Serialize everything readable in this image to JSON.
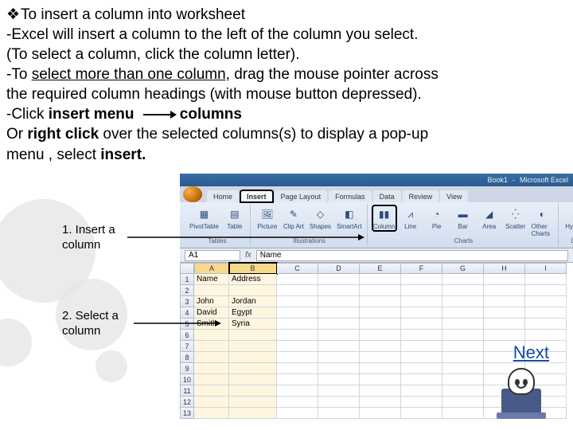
{
  "instructions": {
    "heading_bullet": "❖",
    "heading": "To insert a column into worksheet",
    "line1": "-Excel will insert a column to the left of the column you select.",
    "line2": "(To select a column, click the column letter).",
    "line3_pre": "-To ",
    "line3_under": "select more than one column,",
    "line3_post": " drag the mouse pointer across",
    "line4": "the required column headings (with mouse button depressed).",
    "line5_pre": "-Click ",
    "line5_b1": "insert menu",
    "line5_b2": "columns",
    "line6_pre": "Or ",
    "line6_b": "right click",
    "line6_post": " over the selected columns(s) to display a pop-up",
    "line7_pre": "menu , select ",
    "line7_b": "insert."
  },
  "callouts": {
    "c1": "1. Insert a column",
    "c2": "2. Select a column"
  },
  "excel": {
    "title_doc": "Book1",
    "title_app": "Microsoft Excel",
    "tabs": [
      "Home",
      "Insert",
      "Page Layout",
      "Formulas",
      "Data",
      "Review",
      "View"
    ],
    "active_tab": "Insert",
    "ribbon": [
      {
        "label": "PivotTable",
        "icon": "▦"
      },
      {
        "label": "Table",
        "icon": "▤"
      },
      {
        "label": "Picture",
        "icon": "🖼"
      },
      {
        "label": "Clip Art",
        "icon": "✎"
      },
      {
        "label": "Shapes",
        "icon": "◇"
      },
      {
        "label": "SmartArt",
        "icon": "◧"
      },
      {
        "label": "Column",
        "icon": "▮▮",
        "highlight": true
      },
      {
        "label": "Line",
        "icon": "⩘"
      },
      {
        "label": "Pie",
        "icon": "◔"
      },
      {
        "label": "Bar",
        "icon": "▬"
      },
      {
        "label": "Area",
        "icon": "◢"
      },
      {
        "label": "Scatter",
        "icon": "⁛"
      },
      {
        "label": "Other Charts",
        "icon": "◐"
      },
      {
        "label": "Hyperlink",
        "icon": "🔗"
      }
    ],
    "ribbon_groups": [
      "Tables",
      "Illustrations",
      "Charts",
      "Links"
    ],
    "namebox": "A1",
    "fx": "fx",
    "formula": "Name",
    "columns": [
      "A",
      "B",
      "C",
      "D",
      "E",
      "F",
      "G",
      "H",
      "I"
    ],
    "rows": [
      1,
      2,
      3,
      4,
      5,
      6,
      7,
      8,
      9,
      10,
      11,
      12,
      13
    ],
    "grid": {
      "1": {
        "A": "Name",
        "B": "Address"
      },
      "3": {
        "A": "John",
        "B": "Jordan"
      },
      "4": {
        "A": "David",
        "B": "Egypt"
      },
      "5": {
        "A": "Smith",
        "B": "Syria"
      }
    }
  },
  "next": "Next"
}
